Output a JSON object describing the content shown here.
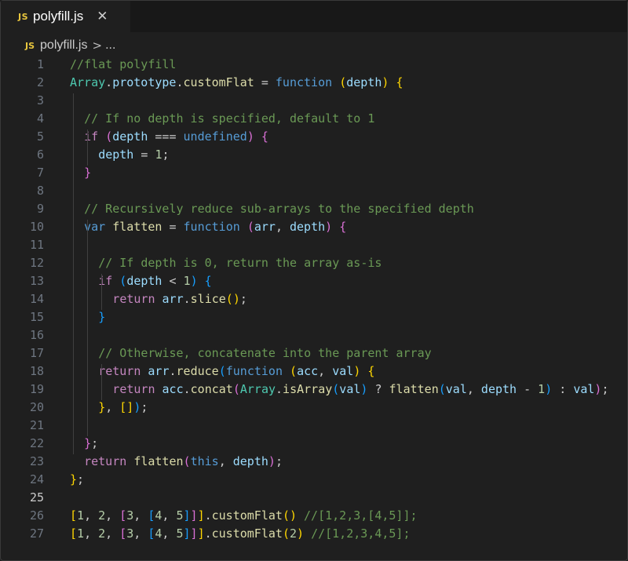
{
  "tab": {
    "badge": "JS",
    "title": "polyfill.js",
    "close_icon": "close-icon"
  },
  "breadcrumb": {
    "badge": "JS",
    "file": "polyfill.js",
    "separator": ">",
    "more": "..."
  },
  "colors": {
    "background": "#1f1f1f",
    "comment": "#6a9955",
    "keyword": "#569cd6",
    "control": "#c586c0",
    "class": "#4ec9b0",
    "variable": "#9cdcfe",
    "function": "#dcdcaa",
    "number": "#b5cea8",
    "bracket_gold": "#ffd700",
    "bracket_pink": "#da70d6",
    "bracket_blue": "#179fff",
    "plain": "#cccccc"
  },
  "active_line": 25,
  "lines": [
    {
      "n": "1",
      "indent": 0,
      "tokens": [
        [
          "//flat polyfill",
          "cm"
        ]
      ]
    },
    {
      "n": "2",
      "indent": 0,
      "tokens": [
        [
          "Array",
          "cl"
        ],
        [
          ".",
          "p"
        ],
        [
          "prototype",
          "vr"
        ],
        [
          ".",
          "p"
        ],
        [
          "customFlat",
          "fn"
        ],
        [
          " = ",
          "p"
        ],
        [
          "function",
          "kw"
        ],
        [
          " ",
          "p"
        ],
        [
          "(",
          "b1"
        ],
        [
          "depth",
          "vr"
        ],
        [
          ")",
          "b1"
        ],
        [
          " ",
          "p"
        ],
        [
          "{",
          "b1"
        ]
      ]
    },
    {
      "n": "3",
      "indent": 0,
      "tokens": []
    },
    {
      "n": "4",
      "indent": 1,
      "tokens": [
        [
          "// If no depth is specified, default to 1",
          "cm"
        ]
      ]
    },
    {
      "n": "5",
      "indent": 1,
      "tokens": [
        [
          "if",
          "ct"
        ],
        [
          " ",
          "p"
        ],
        [
          "(",
          "b2"
        ],
        [
          "depth",
          "vr"
        ],
        [
          " === ",
          "p"
        ],
        [
          "undefined",
          "kw"
        ],
        [
          ")",
          "b2"
        ],
        [
          " ",
          "p"
        ],
        [
          "{",
          "b2"
        ]
      ]
    },
    {
      "n": "6",
      "indent": 2,
      "tokens": [
        [
          "depth",
          "vr"
        ],
        [
          " = ",
          "p"
        ],
        [
          "1",
          "nm"
        ],
        [
          ";",
          "p"
        ]
      ]
    },
    {
      "n": "7",
      "indent": 1,
      "tokens": [
        [
          "}",
          "b2"
        ]
      ]
    },
    {
      "n": "8",
      "indent": 0,
      "tokens": []
    },
    {
      "n": "9",
      "indent": 1,
      "tokens": [
        [
          "// Recursively reduce sub-arrays to the specified depth",
          "cm"
        ]
      ]
    },
    {
      "n": "10",
      "indent": 1,
      "tokens": [
        [
          "var",
          "kw"
        ],
        [
          " ",
          "p"
        ],
        [
          "flatten",
          "fn"
        ],
        [
          " = ",
          "p"
        ],
        [
          "function",
          "kw"
        ],
        [
          " ",
          "p"
        ],
        [
          "(",
          "b2"
        ],
        [
          "arr",
          "vr"
        ],
        [
          ", ",
          "p"
        ],
        [
          "depth",
          "vr"
        ],
        [
          ")",
          "b2"
        ],
        [
          " ",
          "p"
        ],
        [
          "{",
          "b2"
        ]
      ]
    },
    {
      "n": "11",
      "indent": 0,
      "tokens": []
    },
    {
      "n": "12",
      "indent": 2,
      "tokens": [
        [
          "// If depth is 0, return the array as-is",
          "cm"
        ]
      ]
    },
    {
      "n": "13",
      "indent": 2,
      "tokens": [
        [
          "if",
          "ct"
        ],
        [
          " ",
          "p"
        ],
        [
          "(",
          "b3"
        ],
        [
          "depth",
          "vr"
        ],
        [
          " < ",
          "p"
        ],
        [
          "1",
          "nm"
        ],
        [
          ")",
          "b3"
        ],
        [
          " ",
          "p"
        ],
        [
          "{",
          "b3"
        ]
      ]
    },
    {
      "n": "14",
      "indent": 3,
      "tokens": [
        [
          "return",
          "ct"
        ],
        [
          " ",
          "p"
        ],
        [
          "arr",
          "vr"
        ],
        [
          ".",
          "p"
        ],
        [
          "slice",
          "fn"
        ],
        [
          "()",
          "b1"
        ],
        [
          ";",
          "p"
        ]
      ]
    },
    {
      "n": "15",
      "indent": 2,
      "tokens": [
        [
          "}",
          "b3"
        ]
      ]
    },
    {
      "n": "16",
      "indent": 0,
      "tokens": []
    },
    {
      "n": "17",
      "indent": 2,
      "tokens": [
        [
          "// Otherwise, concatenate into the parent array",
          "cm"
        ]
      ]
    },
    {
      "n": "18",
      "indent": 2,
      "tokens": [
        [
          "return",
          "ct"
        ],
        [
          " ",
          "p"
        ],
        [
          "arr",
          "vr"
        ],
        [
          ".",
          "p"
        ],
        [
          "reduce",
          "fn"
        ],
        [
          "(",
          "b3"
        ],
        [
          "function",
          "kw"
        ],
        [
          " ",
          "p"
        ],
        [
          "(",
          "b1"
        ],
        [
          "acc",
          "vr"
        ],
        [
          ", ",
          "p"
        ],
        [
          "val",
          "vr"
        ],
        [
          ")",
          "b1"
        ],
        [
          " ",
          "p"
        ],
        [
          "{",
          "b1"
        ]
      ]
    },
    {
      "n": "19",
      "indent": 3,
      "tokens": [
        [
          "return",
          "ct"
        ],
        [
          " ",
          "p"
        ],
        [
          "acc",
          "vr"
        ],
        [
          ".",
          "p"
        ],
        [
          "concat",
          "fn"
        ],
        [
          "(",
          "b2"
        ],
        [
          "Array",
          "cl"
        ],
        [
          ".",
          "p"
        ],
        [
          "isArray",
          "fn"
        ],
        [
          "(",
          "b3"
        ],
        [
          "val",
          "vr"
        ],
        [
          ")",
          "b3"
        ],
        [
          " ? ",
          "p"
        ],
        [
          "flatten",
          "fn"
        ],
        [
          "(",
          "b3"
        ],
        [
          "val",
          "vr"
        ],
        [
          ", ",
          "p"
        ],
        [
          "depth",
          "vr"
        ],
        [
          " - ",
          "p"
        ],
        [
          "1",
          "nm"
        ],
        [
          ")",
          "b3"
        ],
        [
          " : ",
          "p"
        ],
        [
          "val",
          "vr"
        ],
        [
          ")",
          "b2"
        ],
        [
          ";",
          "p"
        ]
      ]
    },
    {
      "n": "20",
      "indent": 2,
      "tokens": [
        [
          "}",
          "b1"
        ],
        [
          ", ",
          "p"
        ],
        [
          "[]",
          "b1"
        ],
        [
          ")",
          "b3"
        ],
        [
          ";",
          "p"
        ]
      ]
    },
    {
      "n": "21",
      "indent": 0,
      "tokens": []
    },
    {
      "n": "22",
      "indent": 1,
      "tokens": [
        [
          "}",
          "b2"
        ],
        [
          ";",
          "p"
        ]
      ]
    },
    {
      "n": "23",
      "indent": 1,
      "tokens": [
        [
          "return",
          "ct"
        ],
        [
          " ",
          "p"
        ],
        [
          "flatten",
          "fn"
        ],
        [
          "(",
          "b2"
        ],
        [
          "this",
          "kw"
        ],
        [
          ", ",
          "p"
        ],
        [
          "depth",
          "vr"
        ],
        [
          ")",
          "b2"
        ],
        [
          ";",
          "p"
        ]
      ]
    },
    {
      "n": "24",
      "indent": 0,
      "tokens": [
        [
          "}",
          "b1"
        ],
        [
          ";",
          "p"
        ]
      ]
    },
    {
      "n": "25",
      "indent": 0,
      "tokens": []
    },
    {
      "n": "26",
      "indent": 0,
      "tokens": [
        [
          "[",
          "b1"
        ],
        [
          "1",
          "nm"
        ],
        [
          ", ",
          "p"
        ],
        [
          "2",
          "nm"
        ],
        [
          ", ",
          "p"
        ],
        [
          "[",
          "b2"
        ],
        [
          "3",
          "nm"
        ],
        [
          ", ",
          "p"
        ],
        [
          "[",
          "b3"
        ],
        [
          "4",
          "nm"
        ],
        [
          ", ",
          "p"
        ],
        [
          "5",
          "nm"
        ],
        [
          "]",
          "b3"
        ],
        [
          "]",
          "b2"
        ],
        [
          "]",
          "b1"
        ],
        [
          ".",
          "p"
        ],
        [
          "customFlat",
          "fn"
        ],
        [
          "()",
          "b1"
        ],
        [
          " ",
          "p"
        ],
        [
          "//[1,2,3,[4,5]];",
          "cm"
        ]
      ]
    },
    {
      "n": "27",
      "indent": 0,
      "tokens": [
        [
          "[",
          "b1"
        ],
        [
          "1",
          "nm"
        ],
        [
          ", ",
          "p"
        ],
        [
          "2",
          "nm"
        ],
        [
          ", ",
          "p"
        ],
        [
          "[",
          "b2"
        ],
        [
          "3",
          "nm"
        ],
        [
          ", ",
          "p"
        ],
        [
          "[",
          "b3"
        ],
        [
          "4",
          "nm"
        ],
        [
          ", ",
          "p"
        ],
        [
          "5",
          "nm"
        ],
        [
          "]",
          "b3"
        ],
        [
          "]",
          "b2"
        ],
        [
          "]",
          "b1"
        ],
        [
          ".",
          "p"
        ],
        [
          "customFlat",
          "fn"
        ],
        [
          "(",
          "b1"
        ],
        [
          "2",
          "nm"
        ],
        [
          ")",
          "b1"
        ],
        [
          " ",
          "p"
        ],
        [
          "//[1,2,3,4,5];",
          "cm"
        ]
      ]
    }
  ]
}
